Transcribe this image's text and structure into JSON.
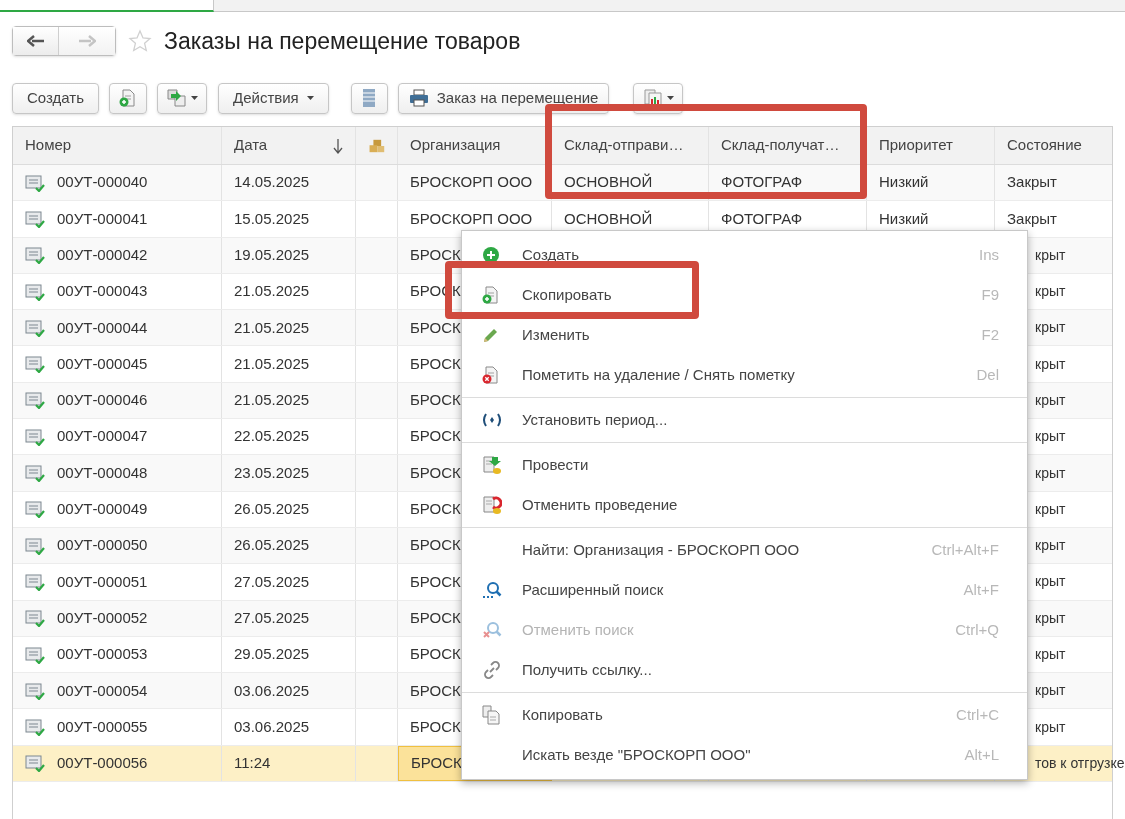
{
  "title": "Заказы на перемещение товаров",
  "toolbar": {
    "create": "Создать",
    "actions": "Действия",
    "print": "Заказ на перемещение"
  },
  "table": {
    "columns": [
      {
        "label": "Номер",
        "sorted": false
      },
      {
        "label": "Дата",
        "sorted": true
      },
      {
        "label": "Организация",
        "sorted": false
      },
      {
        "label": "Склад-отправи…",
        "sorted": false
      },
      {
        "label": "Склад-получат…",
        "sorted": false
      },
      {
        "label": "Приоритет",
        "sorted": false
      },
      {
        "label": "Состояние",
        "sorted": false
      }
    ],
    "rows": [
      {
        "number": "00УТ-000040",
        "date": "14.05.2025",
        "org": "БРОСКОРП ООО",
        "from": "ОСНОВНОЙ",
        "to": "ФОТОГРАФ",
        "priority": "Низкий",
        "status": "Закрыт",
        "covered": false,
        "selected": false
      },
      {
        "number": "00УТ-000041",
        "date": "15.05.2025",
        "org": "БРОСКОРП ООО",
        "from": "ОСНОВНОЙ",
        "to": "ФОТОГРАФ",
        "priority": "Низкий",
        "status": "Закрыт",
        "covered": false,
        "selected": false
      },
      {
        "number": "00УТ-000042",
        "date": "19.05.2025",
        "org": "БРОСК",
        "status": "крыт",
        "covered": true,
        "selected": false
      },
      {
        "number": "00УТ-000043",
        "date": "21.05.2025",
        "org": "БРОСК",
        "status": "крыт",
        "covered": true,
        "selected": false
      },
      {
        "number": "00УТ-000044",
        "date": "21.05.2025",
        "org": "БРОСК",
        "status": "крыт",
        "covered": true,
        "selected": false
      },
      {
        "number": "00УТ-000045",
        "date": "21.05.2025",
        "org": "БРОСК",
        "status": "крыт",
        "covered": true,
        "selected": false
      },
      {
        "number": "00УТ-000046",
        "date": "21.05.2025",
        "org": "БРОСК",
        "status": "крыт",
        "covered": true,
        "selected": false
      },
      {
        "number": "00УТ-000047",
        "date": "22.05.2025",
        "org": "БРОСК",
        "status": "крыт",
        "covered": true,
        "selected": false
      },
      {
        "number": "00УТ-000048",
        "date": "23.05.2025",
        "org": "БРОСК",
        "status": "крыт",
        "covered": true,
        "selected": false
      },
      {
        "number": "00УТ-000049",
        "date": "26.05.2025",
        "org": "БРОСК",
        "status": "крыт",
        "covered": true,
        "selected": false
      },
      {
        "number": "00УТ-000050",
        "date": "26.05.2025",
        "org": "БРОСК",
        "status": "крыт",
        "covered": true,
        "selected": false
      },
      {
        "number": "00УТ-000051",
        "date": "27.05.2025",
        "org": "БРОСК",
        "status": "крыт",
        "covered": true,
        "selected": false
      },
      {
        "number": "00УТ-000052",
        "date": "27.05.2025",
        "org": "БРОСК",
        "status": "крыт",
        "covered": true,
        "selected": false
      },
      {
        "number": "00УТ-000053",
        "date": "29.05.2025",
        "org": "БРОСК",
        "status": "крыт",
        "covered": true,
        "selected": false
      },
      {
        "number": "00УТ-000054",
        "date": "03.06.2025",
        "org": "БРОСК",
        "status": "крыт",
        "covered": true,
        "selected": false
      },
      {
        "number": "00УТ-000055",
        "date": "03.06.2025",
        "org": "БРОСК",
        "status": "крыт",
        "covered": true,
        "selected": false
      },
      {
        "number": "00УТ-000056",
        "date": "11:24",
        "org": "БРОСК",
        "status": "тов к отгрузке",
        "covered": true,
        "selected": true
      }
    ]
  },
  "menu": {
    "groups": [
      [
        {
          "label": "Создать",
          "shortcut": "Ins",
          "disabled": false
        },
        {
          "label": "Скопировать",
          "shortcut": "F9",
          "disabled": false
        },
        {
          "label": "Изменить",
          "shortcut": "F2",
          "disabled": false
        },
        {
          "label": "Пометить на удаление / Снять пометку",
          "shortcut": "Del",
          "disabled": false
        }
      ],
      [
        {
          "label": "Установить период...",
          "disabled": false
        }
      ],
      [
        {
          "label": "Провести",
          "disabled": false
        },
        {
          "label": "Отменить проведение",
          "disabled": false
        }
      ],
      [
        {
          "label": "Найти: Организация - БРОСКОРП ООО",
          "shortcut": "Ctrl+Alt+F",
          "disabled": false
        },
        {
          "label": "Расширенный поиск",
          "shortcut": "Alt+F",
          "disabled": false
        },
        {
          "label": "Отменить поиск",
          "shortcut": "Ctrl+Q",
          "disabled": true
        },
        {
          "label": "Получить ссылку...",
          "disabled": false
        }
      ],
      [
        {
          "label": "Копировать",
          "shortcut": "Ctrl+C",
          "disabled": false
        },
        {
          "label": "Искать везде \"БРОСКОРП ООО\"",
          "shortcut": "Alt+L",
          "disabled": false
        }
      ]
    ]
  }
}
